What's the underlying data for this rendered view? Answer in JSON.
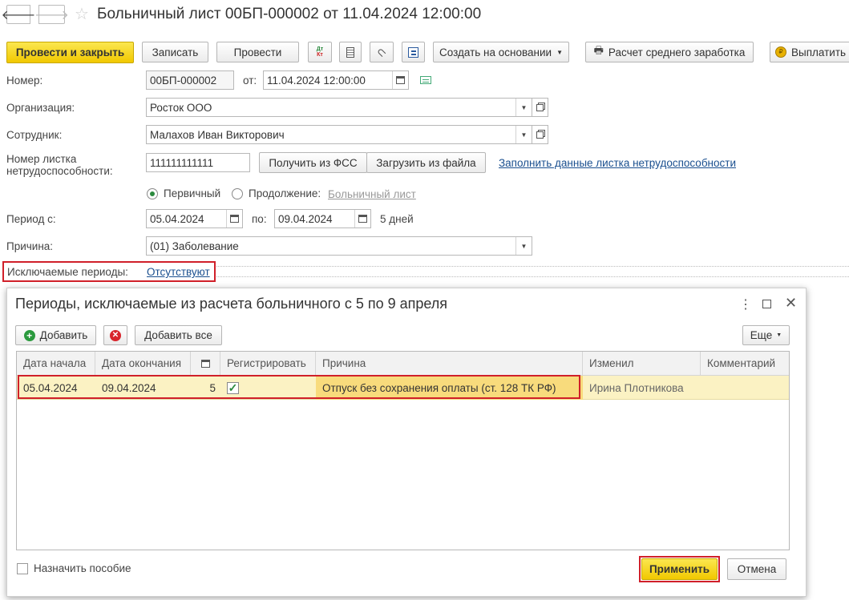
{
  "window": {
    "title": "Больничный лист 00БП-000002 от 11.04.2024 12:00:00"
  },
  "toolbar": {
    "post_close": "Провести и закрыть",
    "save": "Записать",
    "post": "Провести",
    "create_based": "Создать на основании",
    "avg_earnings": "Расчет среднего заработка",
    "pay": "Выплатить"
  },
  "form": {
    "number_label": "Номер:",
    "number_value": "00БП-000002",
    "from_label": "от:",
    "date_value": "11.04.2024 12:00:00",
    "org_label": "Организация:",
    "org_value": "Росток ООО",
    "employee_label": "Сотрудник:",
    "employee_value": "Малахов Иван Викторович",
    "sheet_label": "Номер листка нетрудоспособности:",
    "sheet_value": "111111111111",
    "get_fss": "Получить из ФСС",
    "load_file": "Загрузить из файла",
    "fill_link": "Заполнить данные листка нетрудоспособности",
    "primary": "Первичный",
    "continuation": "Продолжение:",
    "sick_leave_link": "Больничный лист",
    "period_label": "Период с:",
    "period_from": "05.04.2024",
    "period_to_label": "по:",
    "period_to": "09.04.2024",
    "days": "5 дней",
    "reason_label": "Причина:",
    "reason_value": "(01) Заболевание",
    "excluded_label": "Исключаемые периоды:",
    "excluded_link": "Отсутствуют"
  },
  "dialog": {
    "title": "Периоды, исключаемые из расчета больничного с 5 по 9 апреля",
    "add": "Добавить",
    "add_all": "Добавить все",
    "more": "Еще",
    "columns": {
      "start": "Дата начала",
      "end": "Дата окончания",
      "register": "Регистрировать",
      "reason": "Причина",
      "changed": "Изменил",
      "comment": "Комментарий"
    },
    "rows": [
      {
        "start": "05.04.2024",
        "end": "09.04.2024",
        "days": "5",
        "reason": "Отпуск без сохранения оплаты (ст. 128 ТК РФ)",
        "changed": "Ирина Плотникова",
        "comment": ""
      }
    ],
    "assign_benefit": "Назначить пособие",
    "apply": "Применить",
    "cancel": "Отмена"
  }
}
